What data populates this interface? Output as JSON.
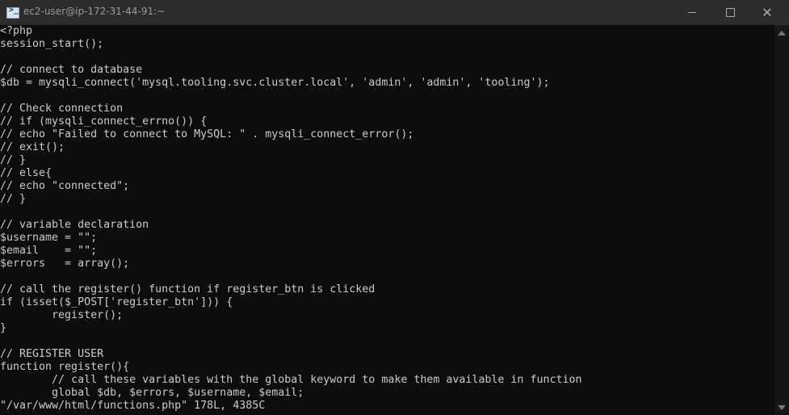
{
  "window": {
    "title": "ec2-user@ip-172-31-44-91:~",
    "icon": "powershell-terminal-icon",
    "close_glyph": "✕"
  },
  "terminal": {
    "lines": [
      "<?php",
      "session_start();",
      "",
      "// connect to database",
      "$db = mysqli_connect('mysql.tooling.svc.cluster.local', 'admin', 'admin', 'tooling');",
      "",
      "// Check connection",
      "// if (mysqli_connect_errno()) {",
      "// echo \"Failed to connect to MySQL: \" . mysqli_connect_error();",
      "// exit();",
      "// }",
      "// else{",
      "// echo \"connected\";",
      "// }",
      "",
      "// variable declaration",
      "$username = \"\";",
      "$email    = \"\";",
      "$errors   = array();",
      "",
      "// call the register() function if register_btn is clicked",
      "if (isset($_POST['register_btn'])) {",
      "        register();",
      "}",
      "",
      "// REGISTER USER",
      "function register(){",
      "        // call these variables with the global keyword to make them available in function",
      "        global $db, $errors, $username, $email;"
    ],
    "status_line": "\"/var/www/html/functions.php\" 178L, 4385C"
  },
  "colors": {
    "background": "#0c0c0c",
    "text": "#cccccc",
    "titlebar": "#2c2c2c"
  }
}
